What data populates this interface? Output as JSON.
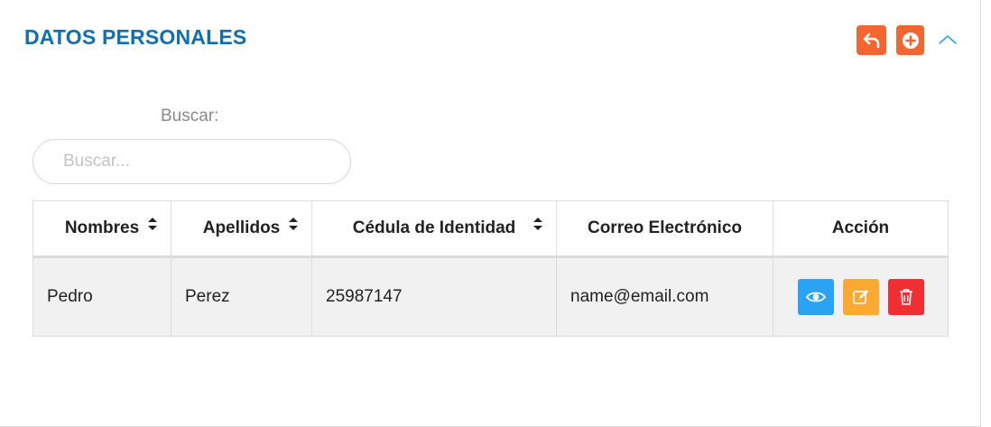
{
  "panel": {
    "title": "DATOS PERSONALES",
    "back_icon": "undo-arrow-icon",
    "add_icon": "plus-circle-icon",
    "collapse_icon": "chevron-up-icon",
    "accent_color": "#f4652f",
    "title_color": "#0f6fb3"
  },
  "search": {
    "label": "Buscar:",
    "placeholder": "Buscar...",
    "value": ""
  },
  "table": {
    "columns": [
      {
        "label": "Nombres",
        "sortable": true
      },
      {
        "label": "Apellidos",
        "sortable": true
      },
      {
        "label": "Cédula de Identidad",
        "sortable": true
      },
      {
        "label": "Correo Electrónico",
        "sortable": false
      },
      {
        "label": "Acción",
        "sortable": false
      }
    ],
    "rows": [
      {
        "nombres": "Pedro",
        "apellidos": "Perez",
        "cedula": "25987147",
        "correo": "name@email.com",
        "actions": [
          "eye-icon",
          "edit-icon",
          "trash-icon"
        ]
      }
    ]
  },
  "action_colors": {
    "view": "#2aa3f4",
    "edit": "#fba933",
    "delete": "#f02f35"
  }
}
